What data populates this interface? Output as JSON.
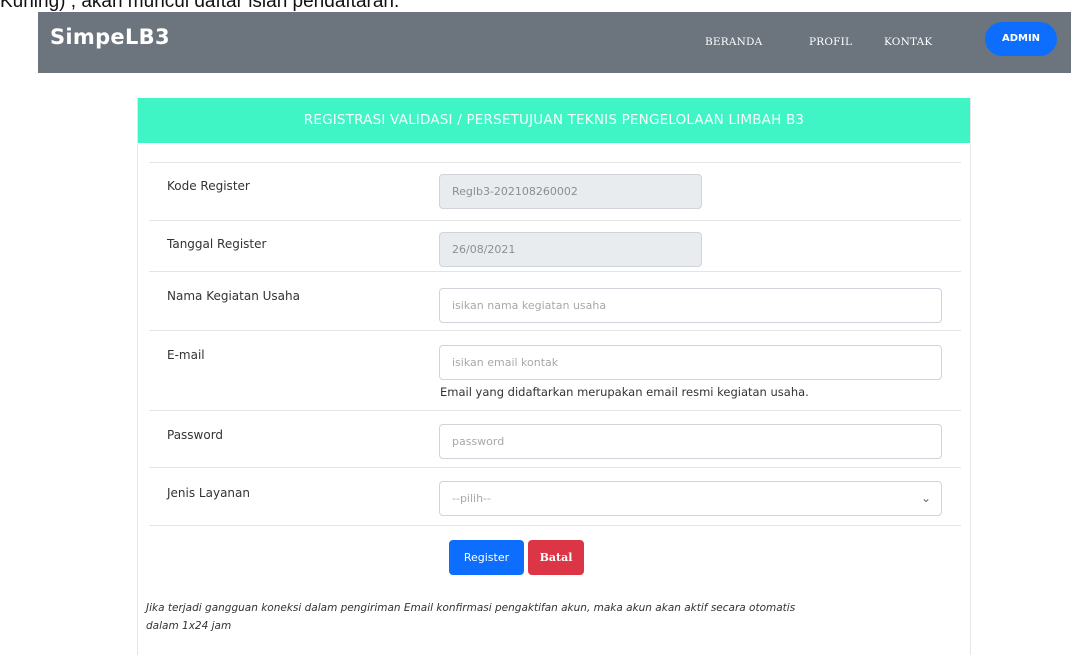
{
  "top_text": "Kuning) , akan muncul daftar isian pendaftaran.",
  "navbar": {
    "brand": "SimpeLB3",
    "links": [
      "BERANDA",
      "PROFIL",
      "KONTAK"
    ],
    "admin_label": "ADMIN",
    "colors": {
      "background": "#6c757d",
      "admin": "#0d6efd"
    }
  },
  "form": {
    "header": "REGISTRASI VALIDASI / PERSETUJUAN TEKNIS PENGELOLAAN LIMBAH B3",
    "header_color": "#3ff5c6",
    "fields": [
      {
        "label": "Kode Register",
        "value": "Reglb3-202108260002"
      },
      {
        "label": "Tanggal Register",
        "value": "26/08/2021"
      },
      {
        "label": "Nama Kegiatan Usaha",
        "placeholder": "isikan nama kegiatan usaha"
      },
      {
        "label": "E-mail",
        "placeholder": "isikan email kontak",
        "help": "Email yang didaftarkan merupakan email resmi kegiatan usaha."
      },
      {
        "label": "Password",
        "placeholder": "password"
      },
      {
        "label": "Jenis Layanan",
        "selected": "--pilih--"
      }
    ],
    "buttons": {
      "register": "Register",
      "batal": "Batal",
      "register_color": "#0d6efd",
      "batal_color": "#dc3545"
    },
    "note_line1": "Jika terjadi gangguan koneksi dalam pengiriman Email konfirmasi pengaktifan akun, maka akun akan aktif secara otomatis",
    "note_line2": "dalam 1x24 jam"
  }
}
